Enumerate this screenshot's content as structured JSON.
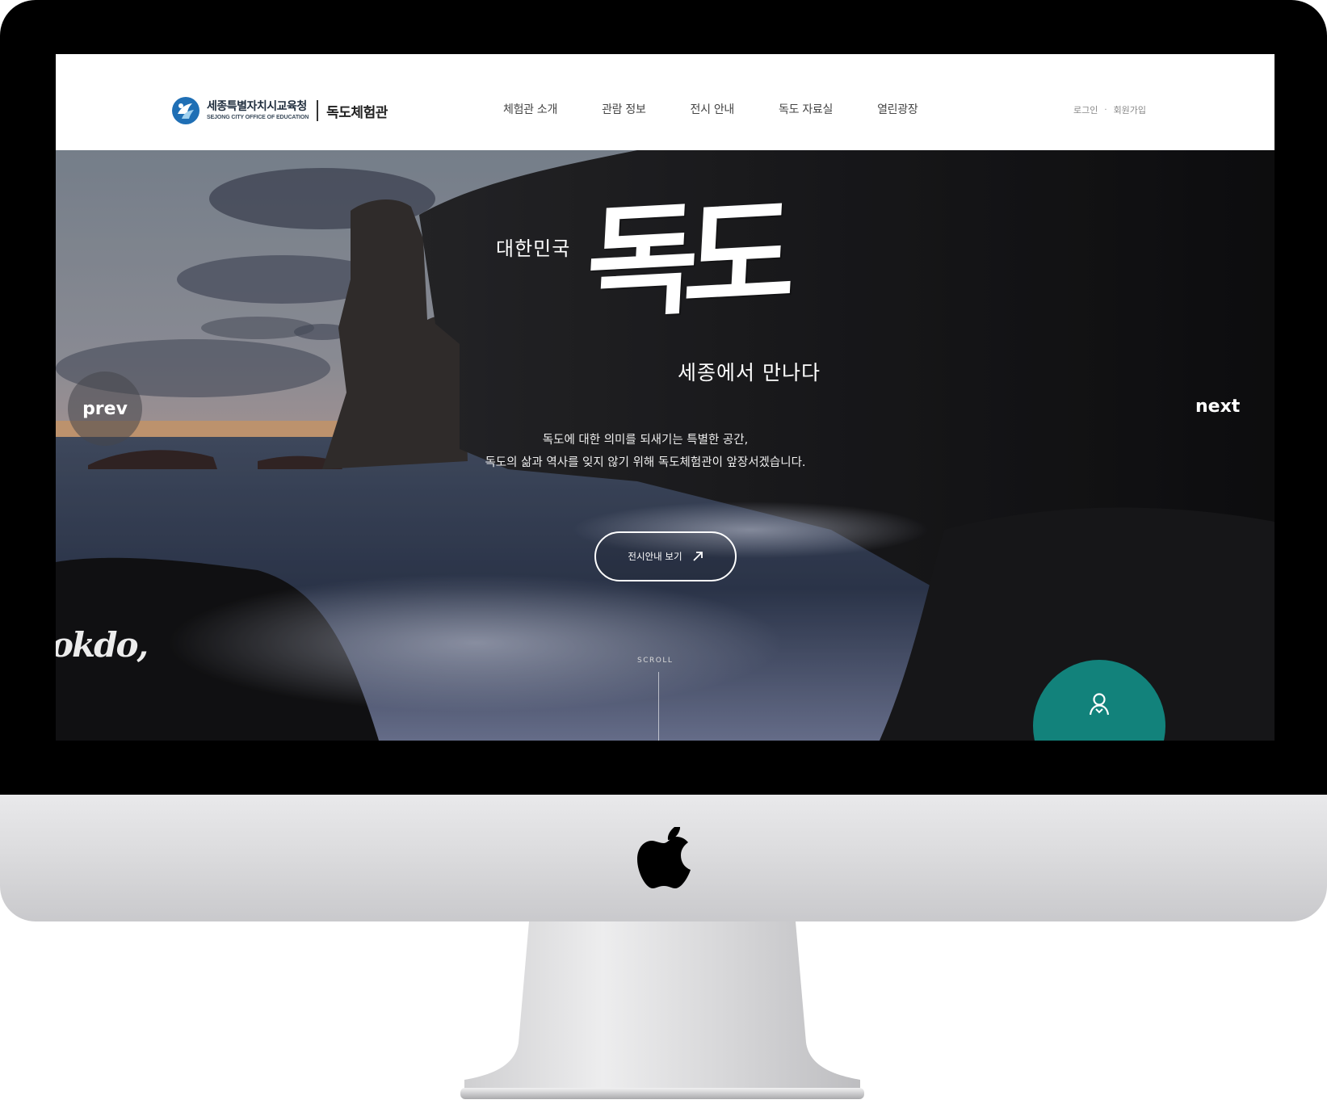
{
  "header": {
    "logo_org_ko": "세종특별자치시교육청",
    "logo_org_en": "SEJONG CITY OFFICE OF EDUCATION",
    "logo_site": "독도체험관"
  },
  "nav": {
    "items": [
      {
        "label": "체험관 소개"
      },
      {
        "label": "관람 정보"
      },
      {
        "label": "전시 안내"
      },
      {
        "label": "독도 자료실"
      },
      {
        "label": "열린광장"
      }
    ]
  },
  "util": {
    "login": "로그인",
    "separator": "·",
    "signup": "회원가입"
  },
  "hero": {
    "title_small": "대한민국",
    "title_big": "독도",
    "title_sub": "세종에서 만나다",
    "desc_line1": "독도에 대한 의미를 되새기는 특별한 공간,",
    "desc_line2": "독도의 삶과 역사를 잊지 않기 위해 독도체험관이 앞장서겠습니다.",
    "cta_label": "전시안내 보기",
    "prev_label": "prev",
    "next_label": "next",
    "scroll_label": "SCROLL",
    "watermark": "okdo,"
  },
  "colors": {
    "accent_teal": "#12827b",
    "emblem_blue": "#1f6fb5"
  },
  "icons": {
    "cta_arrow": "arrow-up-right-icon",
    "quick_menu": "user-icon"
  }
}
